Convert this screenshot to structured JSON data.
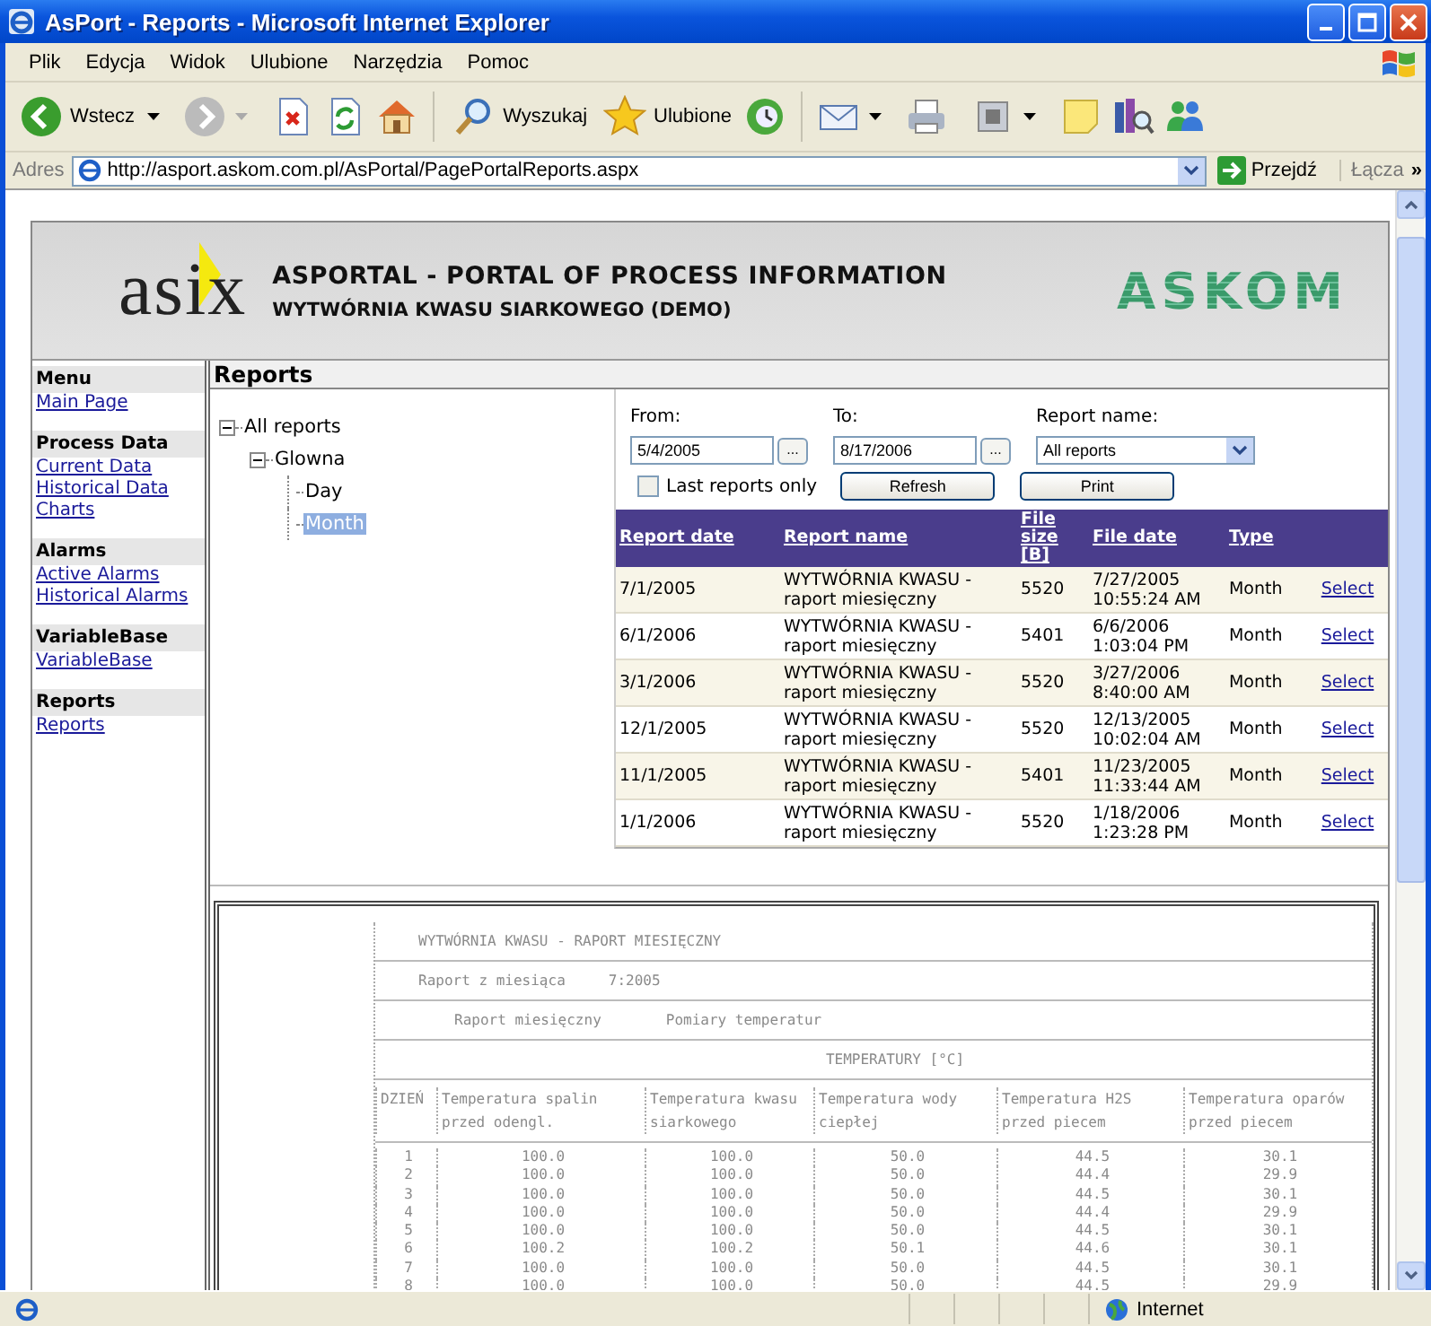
{
  "window": {
    "title": "AsPort - Reports - Microsoft Internet Explorer"
  },
  "menu_bar": [
    "Plik",
    "Edycja",
    "Widok",
    "Ulubione",
    "Narzędzia",
    "Pomoc"
  ],
  "toolbar": {
    "back": "Wstecz",
    "search": "Wyszukaj",
    "favorites": "Ulubione"
  },
  "address_bar": {
    "label": "Adres",
    "url": "http://asport.askom.com.pl/AsPortal/PagePortalReports.aspx",
    "go": "Przejdź",
    "links": "Łącza",
    "more": "»"
  },
  "header": {
    "logo": "asix",
    "title": "ASPORTAL - PORTAL OF PROCESS INFORMATION",
    "subtitle": "WYTWÓRNIA KWASU SIARKOWEGO (DEMO)",
    "brand": "ASKOM"
  },
  "sidebar": [
    {
      "heading": "Menu",
      "links": [
        "Main Page"
      ]
    },
    {
      "heading": "Process Data",
      "links": [
        "Current Data",
        "Historical Data",
        "Charts"
      ]
    },
    {
      "heading": "Alarms",
      "links": [
        "Active Alarms",
        "Historical Alarms"
      ]
    },
    {
      "heading": "VariableBase",
      "links": [
        "VariableBase"
      ]
    },
    {
      "heading": "Reports",
      "links": [
        "Reports"
      ]
    }
  ],
  "page_title": "Reports",
  "tree": [
    {
      "label": "All reports",
      "expanded": true,
      "selected": false,
      "children": [
        {
          "label": "Glowna",
          "expanded": true,
          "selected": false,
          "children": [
            {
              "label": "Day",
              "selected": false
            },
            {
              "label": "Month",
              "selected": true
            }
          ]
        }
      ]
    }
  ],
  "filters": {
    "from_label": "From:",
    "from_value": "5/4/2005",
    "from_picker": "...",
    "to_label": "To:",
    "to_value": "8/17/2006",
    "to_picker": "...",
    "report_name_label": "Report name:",
    "report_name_value": "All reports",
    "last_only": {
      "label": "Last reports only",
      "checked": false
    },
    "buttons": [
      "Refresh",
      "Print"
    ]
  },
  "table": {
    "columns": [
      "Report date",
      "Report name",
      "File size [B]",
      "File date",
      "Type"
    ],
    "rows": [
      {
        "cells": [
          "7/1/2005",
          "WYTWÓRNIA KWASU - raport miesięczny",
          "5520",
          "7/27/2005 10:55:24 AM",
          "Month"
        ],
        "action": "Select"
      },
      {
        "cells": [
          "6/1/2006",
          "WYTWÓRNIA KWASU - raport miesięczny",
          "5401",
          "6/6/2006 1:03:04 PM",
          "Month"
        ],
        "action": "Select"
      },
      {
        "cells": [
          "3/1/2006",
          "WYTWÓRNIA KWASU - raport miesięczny",
          "5520",
          "3/27/2006 8:40:00 AM",
          "Month"
        ],
        "action": "Select"
      },
      {
        "cells": [
          "12/1/2005",
          "WYTWÓRNIA KWASU - raport miesięczny",
          "5520",
          "12/13/2005 10:02:04 AM",
          "Month"
        ],
        "action": "Select"
      },
      {
        "cells": [
          "11/1/2005",
          "WYTWÓRNIA KWASU - raport miesięczny",
          "5401",
          "11/23/2005 11:33:44 AM",
          "Month"
        ],
        "action": "Select"
      },
      {
        "cells": [
          "1/1/2006",
          "WYTWÓRNIA KWASU - raport miesięczny",
          "5520",
          "1/18/2006 1:23:28 PM",
          "Month"
        ],
        "action": "Select"
      }
    ]
  },
  "report_preview": {
    "title": "WYTWÓRNIA KWASU - RAPORT MIESIĘCZNY",
    "period_label": "Raport z miesiąca",
    "period": "7:2005",
    "report_type": "Raport miesięczny",
    "measurement": "Pomiary temperatur",
    "table_title": "TEMPERATURY [°C]",
    "columns": [
      "DZIEŃ",
      "Temperatura spalin przed odengl.",
      "Temperatura kwasu siarkowego",
      "Temperatura wody ciepłej",
      "Temperatura H2S przed piecem",
      "Temperatura oparów przed piecem"
    ],
    "rows": [
      [
        "1",
        "100.0",
        "100.0",
        "50.0",
        "44.5",
        "30.1"
      ],
      [
        "2",
        "100.0",
        "100.0",
        "50.0",
        "44.4",
        "29.9"
      ],
      [
        "3",
        "100.0",
        "100.0",
        "50.0",
        "44.5",
        "30.1"
      ],
      [
        "4",
        "100.0",
        "100.0",
        "50.0",
        "44.4",
        "29.9"
      ],
      [
        "5",
        "100.0",
        "100.0",
        "50.0",
        "44.5",
        "30.1"
      ],
      [
        "6",
        "100.2",
        "100.2",
        "50.1",
        "44.6",
        "30.1"
      ],
      [
        "7",
        "100.0",
        "100.0",
        "50.0",
        "44.5",
        "30.1"
      ],
      [
        "8",
        "100.0",
        "100.0",
        "50.0",
        "44.5",
        "29.9"
      ]
    ]
  },
  "status_bar": {
    "zone": "Internet"
  }
}
